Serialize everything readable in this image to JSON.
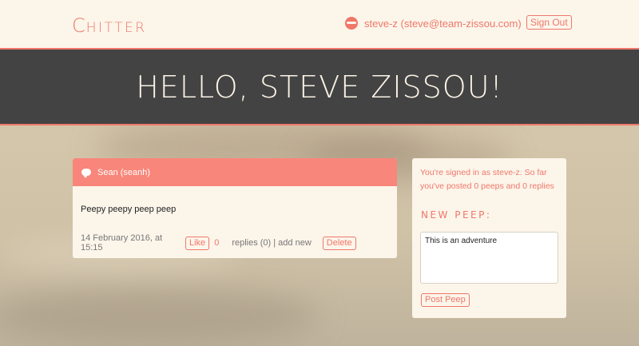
{
  "header": {
    "logo_first": "C",
    "logo_rest": "HITTER",
    "user_label": "steve-z (steve@team-zissou.com)",
    "sign_out": "Sign Out"
  },
  "hero": {
    "title": "HELLO, STEVE ZISSOU!"
  },
  "peep": {
    "author": "Sean (seanh)",
    "text": "Peepy peepy peep peep",
    "timestamp": "14 February 2016, at 15:15",
    "like_label": "Like",
    "like_count": "0",
    "replies_text": "replies (0) | add new",
    "delete_label": "Delete"
  },
  "sidebar": {
    "signed_in_text": "You're signed in as steve-z. So far you've posted 0 peeps and 0 replies",
    "new_peep_title": "NEW PEEP:",
    "input_value": "This is an adventure",
    "post_button": "Post Peep"
  },
  "colors": {
    "accent": "#f0776a",
    "header_bg": "#fcf5ea",
    "hero_bg": "#434343",
    "card_head": "#f8867a"
  }
}
